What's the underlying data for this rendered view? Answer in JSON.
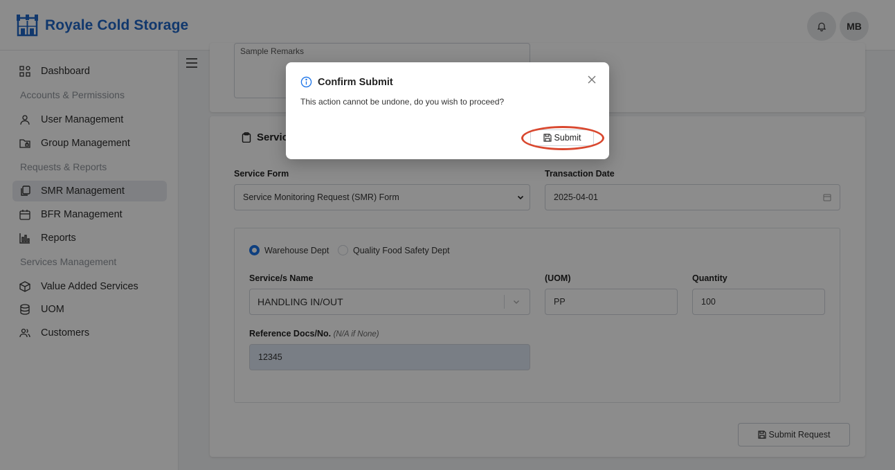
{
  "app": {
    "name": "Royale Cold Storage",
    "user_initials": "MB",
    "brand_color": "#1f66c7"
  },
  "sidebar": {
    "items": [
      {
        "label": "Dashboard",
        "icon": "dashboard-icon"
      },
      {
        "section": "Accounts & Permissions"
      },
      {
        "label": "User Management",
        "icon": "user-icon"
      },
      {
        "label": "Group Management",
        "icon": "folder-lock-icon"
      },
      {
        "section": "Requests & Reports"
      },
      {
        "label": "SMR Management",
        "icon": "copy-icon",
        "active": true
      },
      {
        "label": "BFR Management",
        "icon": "calendar-icon"
      },
      {
        "label": "Reports",
        "icon": "bar-chart-icon"
      },
      {
        "section": "Services Management"
      },
      {
        "label": "Value Added Services",
        "icon": "box-icon"
      },
      {
        "label": "UOM",
        "icon": "database-icon"
      },
      {
        "label": "Customers",
        "icon": "users-icon"
      }
    ]
  },
  "form": {
    "remarks_value": "Sample Remarks",
    "section_title": "Service",
    "service_form_label": "Service Form",
    "service_form_value": "Service Monitoring Request (SMR) Form",
    "transaction_date_label": "Transaction Date",
    "transaction_date_value": "2025-04-01",
    "dept_options": [
      "Warehouse Dept",
      "Quality Food Safety Dept"
    ],
    "dept_selected": "Warehouse Dept",
    "service_name_label": "Service/s Name",
    "service_name_value": "HANDLING IN/OUT",
    "uom_label": "(UOM)",
    "uom_value": "PP",
    "quantity_label": "Quantity",
    "quantity_value": "100",
    "ref_docs_label": "Reference Docs/No.",
    "ref_docs_hint": "(N/A if None)",
    "ref_docs_value": "12345",
    "submit_request_label": "Submit Request"
  },
  "modal": {
    "title": "Confirm Submit",
    "message": "This action cannot be undone, do you wish to proceed?",
    "submit_label": "Submit",
    "highlight_color": "#d9482f"
  }
}
